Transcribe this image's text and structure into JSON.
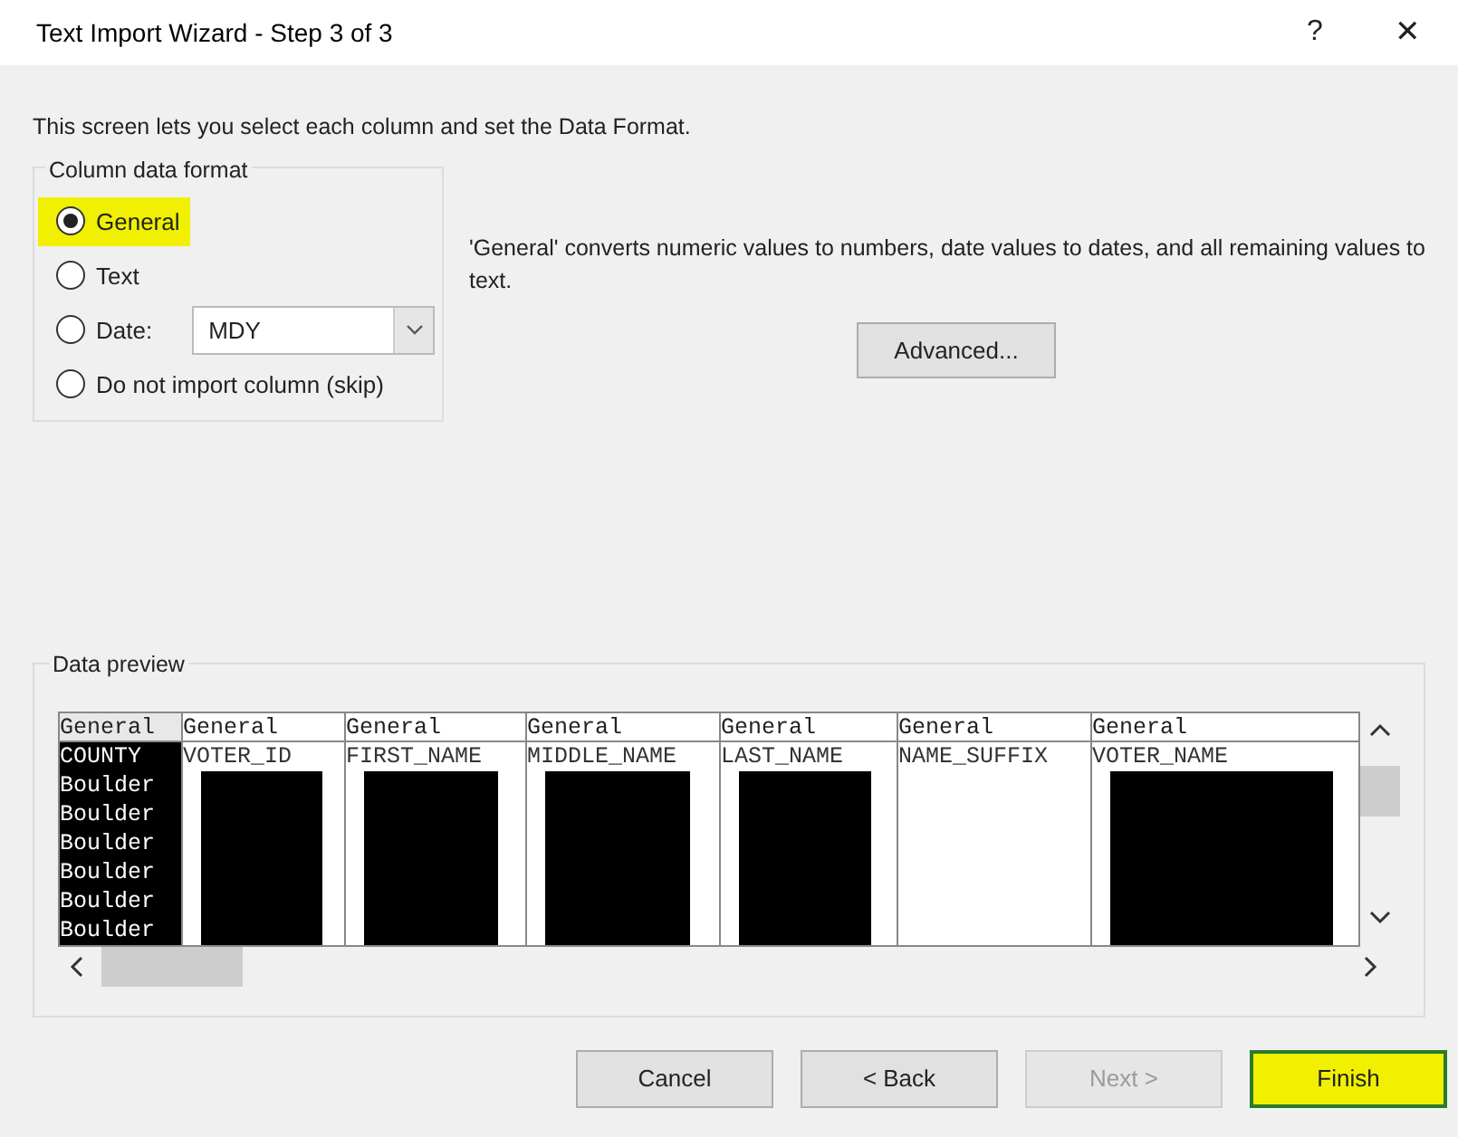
{
  "window": {
    "title": "Text Import Wizard - Step 3 of 3",
    "help": "?",
    "close": "✕"
  },
  "intro": "This screen lets you select each column and set the Data Format.",
  "format_group": {
    "title": "Column data format",
    "options": [
      {
        "kind": "radio",
        "label": "General",
        "selected": true,
        "highlighted": true
      },
      {
        "kind": "radio",
        "label": "Text",
        "selected": false,
        "highlighted": false
      },
      {
        "kind": "date",
        "label": "Date:",
        "selected": false,
        "highlighted": false,
        "value": "MDY"
      },
      {
        "kind": "radio",
        "label": "Do not import column (skip)",
        "selected": false,
        "highlighted": false
      }
    ]
  },
  "description": "'General' converts numeric values to numbers, date values to dates, and all remaining values to text.",
  "advanced_button": "Advanced...",
  "preview": {
    "title": "Data preview",
    "columns": [
      {
        "format": "General",
        "selected": true
      },
      {
        "format": "General",
        "selected": false
      },
      {
        "format": "General",
        "selected": false
      },
      {
        "format": "General",
        "selected": false
      },
      {
        "format": "General",
        "selected": false
      },
      {
        "format": "General",
        "selected": false
      },
      {
        "format": "General",
        "selected": false
      }
    ],
    "rows": [
      [
        "COUNTY",
        "VOTER_ID",
        "FIRST_NAME",
        "MIDDLE_NAME",
        "LAST_NAME",
        "NAME_SUFFIX",
        "VOTER_NAME"
      ],
      [
        "Boulder",
        "",
        "",
        "",
        "",
        "",
        ""
      ],
      [
        "Boulder",
        "",
        "",
        "",
        "",
        "",
        ""
      ],
      [
        "Boulder",
        "",
        "",
        "",
        "",
        "",
        ""
      ],
      [
        "Boulder",
        "",
        "",
        "",
        "",
        "",
        ""
      ],
      [
        "Boulder",
        "",
        "",
        "",
        "",
        "",
        ""
      ],
      [
        "Boulder",
        "",
        "",
        "",
        "",
        "",
        ""
      ]
    ]
  },
  "buttons": [
    {
      "label": "Cancel",
      "disabled": false,
      "highlighted": false
    },
    {
      "label": "< Back",
      "disabled": false,
      "highlighted": false
    },
    {
      "label": "Next >",
      "disabled": true,
      "highlighted": false
    },
    {
      "label": "Finish",
      "disabled": false,
      "highlighted": true
    }
  ]
}
